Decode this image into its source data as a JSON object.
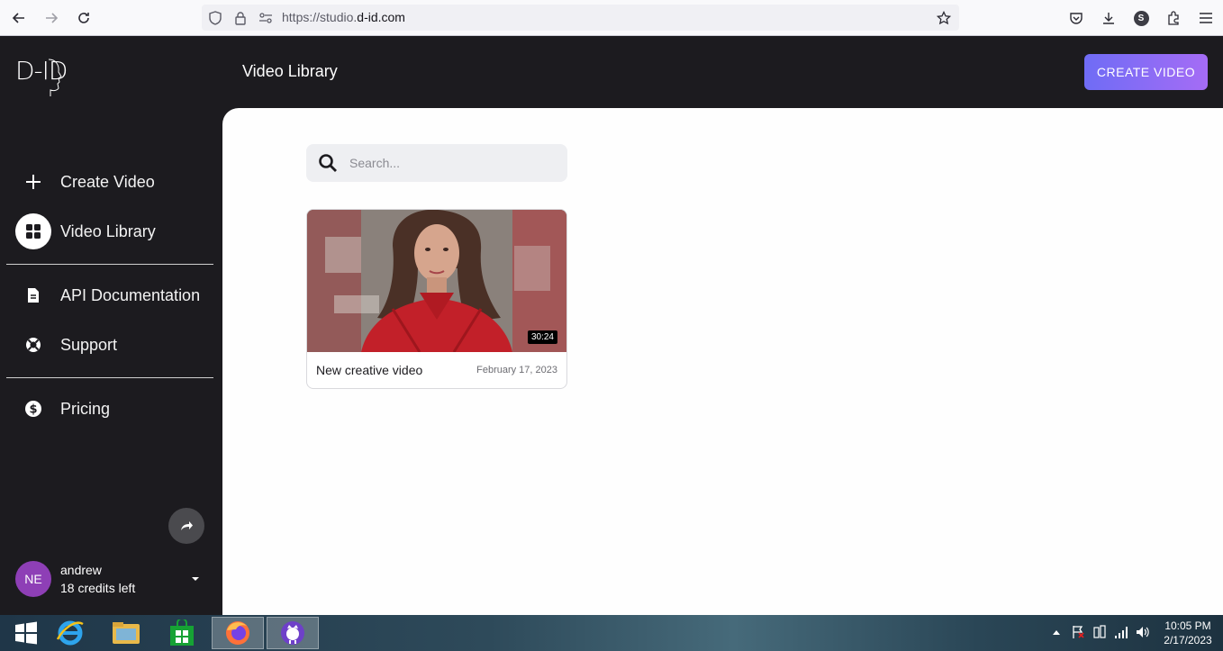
{
  "browser": {
    "url_prefix": "https://studio.",
    "url_host": "d-id.com",
    "profile_letter": "S"
  },
  "app": {
    "logo": "D-ID",
    "page_title": "Video Library",
    "create_button": "CREATE VIDEO"
  },
  "sidebar": {
    "items": [
      {
        "label": "Create Video",
        "icon": "plus-icon"
      },
      {
        "label": "Video Library",
        "icon": "grid-icon"
      },
      {
        "label": "API Documentation",
        "icon": "document-icon"
      },
      {
        "label": "Support",
        "icon": "lifebuoy-icon"
      },
      {
        "label": "Pricing",
        "icon": "dollar-icon"
      }
    ],
    "user": {
      "initials": "NE",
      "name": "andrew",
      "credits": "18 credits left"
    }
  },
  "library": {
    "search_placeholder": "Search...",
    "videos": [
      {
        "title": "New creative video",
        "date": "February 17, 2023",
        "duration": "30:24"
      }
    ]
  },
  "taskbar": {
    "time": "10:05 PM",
    "date": "2/17/2023"
  },
  "colors": {
    "sidebar_bg": "#1c1b1f",
    "accent_start": "#6f6cf5",
    "accent_end": "#a56cf5",
    "avatar": "#8e3fb6"
  }
}
